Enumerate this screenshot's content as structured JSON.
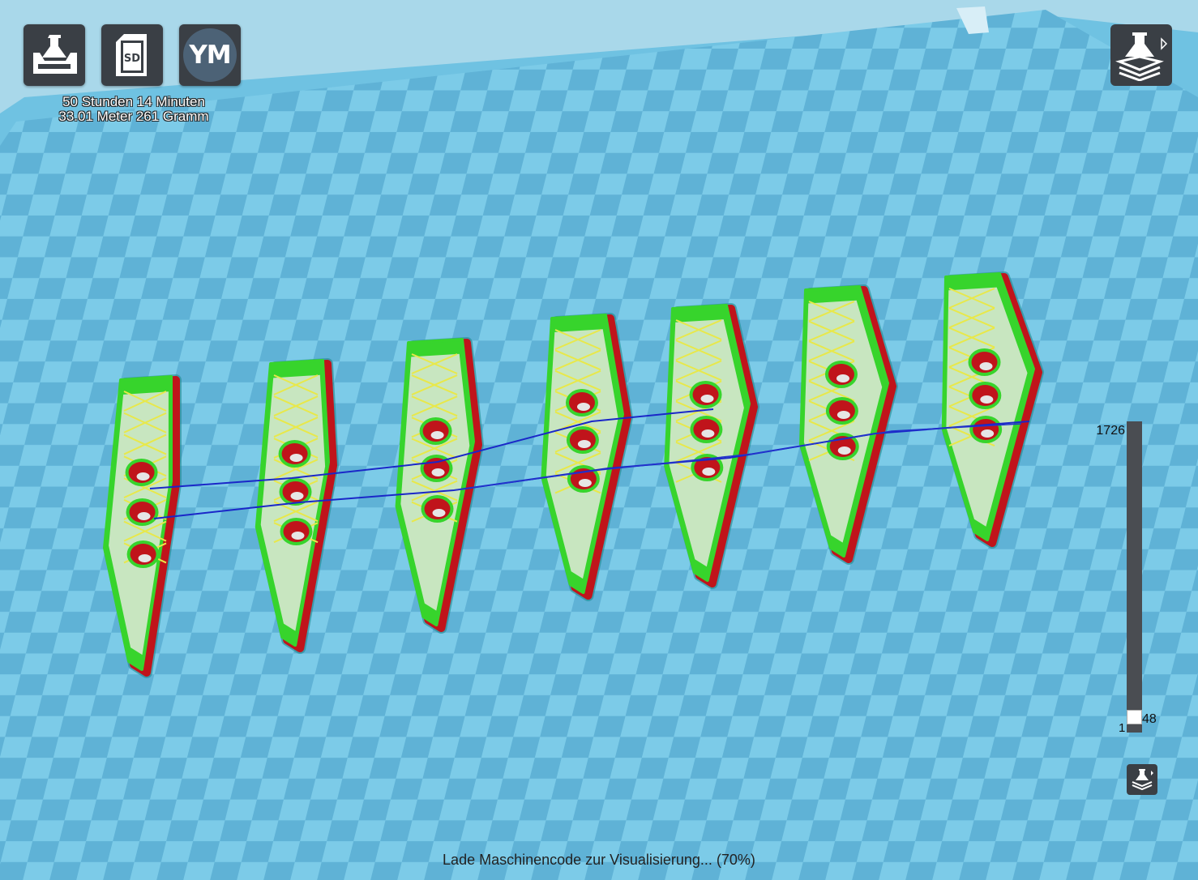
{
  "toolbar": {
    "load_icon": "open-file-icon",
    "sd_icon": "sd-card-icon",
    "sd_label": "SD",
    "profile_label": "YM"
  },
  "print_stats": {
    "time": "50 Stunden 14 Minuten",
    "material": "33.01 Meter 261 Gramm"
  },
  "view_mode": {
    "icon": "layer-view-icon"
  },
  "layer_slider": {
    "max_label": "1726",
    "min_label": "1",
    "current_label": "48",
    "max_layer": 1726,
    "current_layer": 48,
    "min_layer": 1
  },
  "status": {
    "text": "Lade Maschinencode zur Visualisierung... (70%)",
    "progress_percent": 70
  },
  "colors": {
    "bed_light": "#7ccbe8",
    "bed_dark": "#5aaed3",
    "wall_outer": "#c0141b",
    "wall_inner": "#37d42c",
    "infill": "#e8e84a",
    "travel": "#1a27c8",
    "skirt": "#1f8a8f",
    "button_bg": "#3a3f45"
  }
}
